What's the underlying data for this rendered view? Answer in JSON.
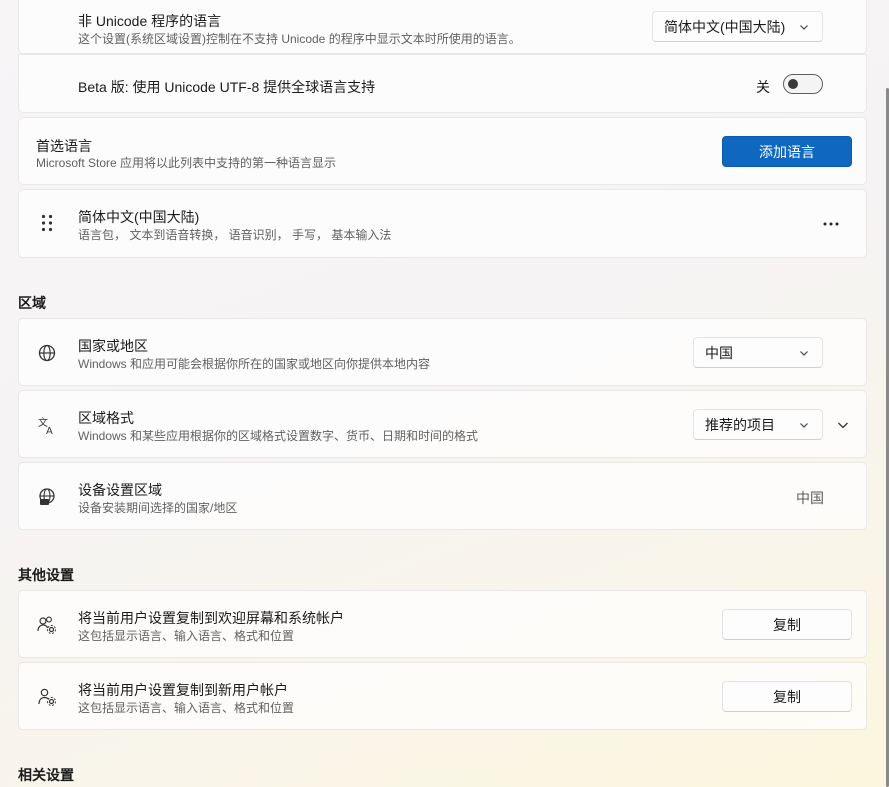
{
  "language": {
    "non_unicode": {
      "title": "非 Unicode 程序的语言",
      "subtitle": "这个设置(系统区域设置)控制在不支持 Unicode 的程序中显示文本时所使用的语言。",
      "dropdown_value": "简体中文(中国大陆)"
    },
    "utf8_beta": {
      "title": "Beta 版: 使用 Unicode UTF-8 提供全球语言支持",
      "toggle_state": "关"
    },
    "preferred": {
      "title": "首选语言",
      "subtitle": "Microsoft Store 应用将以此列表中支持的第一种语言显示",
      "add_button": "添加语言"
    },
    "installed": [
      {
        "name": "简体中文(中国大陆)",
        "features": "语言包， 文本到语音转换， 语音识别， 手写， 基本输入法",
        "more_icon": "more-icon"
      }
    ]
  },
  "region": {
    "header": "区域",
    "country": {
      "title": "国家或地区",
      "subtitle": "Windows 和应用可能会根据你所在的国家或地区向你提供本地内容",
      "dropdown_value": "中国",
      "icon": "globe-icon"
    },
    "format": {
      "title": "区域格式",
      "subtitle": "Windows 和某些应用根据你的区域格式设置数字、货币、日期和时间的格式",
      "dropdown_value": "推荐的项目",
      "icon": "language-format-icon"
    },
    "device": {
      "title": "设备设置区域",
      "subtitle": "设备安装期间选择的国家/地区",
      "value": "中国",
      "icon": "globe-device-icon"
    }
  },
  "other": {
    "header": "其他设置",
    "copy_welcome": {
      "title": "将当前用户设置复制到欢迎屏幕和系统帐户",
      "subtitle": "这包括显示语言、输入语言、格式和位置",
      "button": "复制",
      "icon": "users-settings-icon"
    },
    "copy_new_user": {
      "title": "将当前用户设置复制到新用户帐户",
      "subtitle": "这包括显示语言、输入语言、格式和位置",
      "button": "复制",
      "icon": "user-settings-icon"
    }
  },
  "related": {
    "header": "相关设置"
  },
  "colors": {
    "accent": "#0f67c0"
  }
}
